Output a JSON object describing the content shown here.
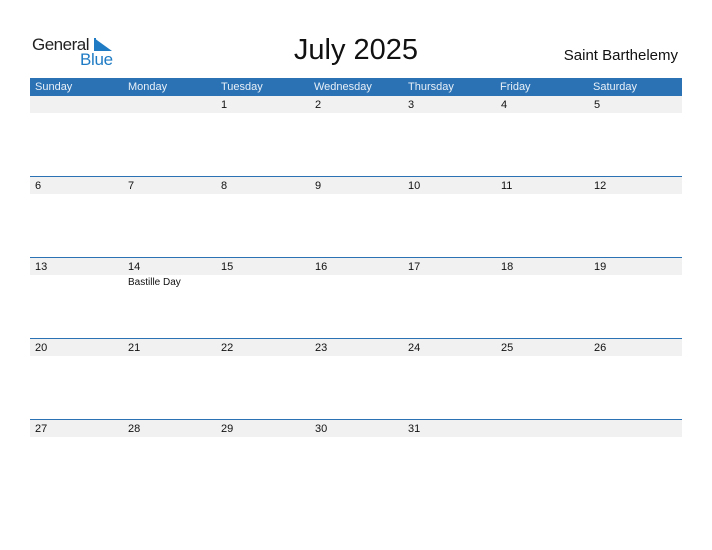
{
  "logo": {
    "word1": "General",
    "word2": "Blue",
    "icon": "blue-triangle-icon",
    "accent": "#1f7bc4"
  },
  "title": "July 2025",
  "country": "Saint Barthelemy",
  "colors": {
    "header_bg": "#2b72b4",
    "strip_bg": "#f1f1f1"
  },
  "weekdays": [
    "Sunday",
    "Monday",
    "Tuesday",
    "Wednesday",
    "Thursday",
    "Friday",
    "Saturday"
  ],
  "weeks": [
    {
      "days": [
        "",
        "",
        "1",
        "2",
        "3",
        "4",
        "5"
      ],
      "events": [
        "",
        "",
        "",
        "",
        "",
        "",
        ""
      ]
    },
    {
      "days": [
        "6",
        "7",
        "8",
        "9",
        "10",
        "11",
        "12"
      ],
      "events": [
        "",
        "",
        "",
        "",
        "",
        "",
        ""
      ]
    },
    {
      "days": [
        "13",
        "14",
        "15",
        "16",
        "17",
        "18",
        "19"
      ],
      "events": [
        "",
        "Bastille Day",
        "",
        "",
        "",
        "",
        ""
      ]
    },
    {
      "days": [
        "20",
        "21",
        "22",
        "23",
        "24",
        "25",
        "26"
      ],
      "events": [
        "",
        "",
        "",
        "",
        "",
        "",
        ""
      ]
    },
    {
      "days": [
        "27",
        "28",
        "29",
        "30",
        "31",
        "",
        ""
      ],
      "events": [
        "",
        "",
        "",
        "",
        "",
        "",
        ""
      ]
    }
  ]
}
